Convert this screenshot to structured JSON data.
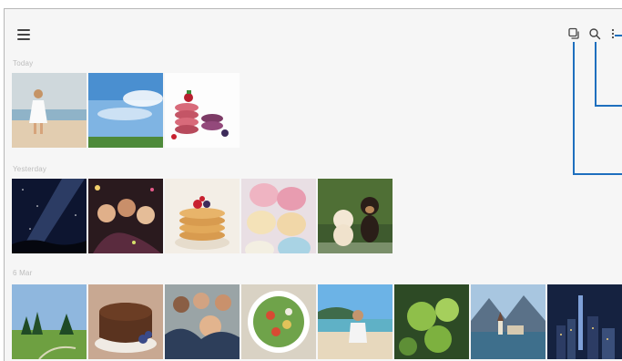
{
  "app_bar": {
    "menu_icon": "hamburger-menu-icon",
    "actions": [
      {
        "name": "select-mode-icon"
      },
      {
        "name": "search-icon"
      },
      {
        "name": "more-options-icon"
      }
    ]
  },
  "sections": {
    "today": {
      "label": "Today"
    },
    "yesterday": {
      "label": "Yesterday"
    },
    "older": {
      "label": "6 Mar"
    }
  },
  "photos": {
    "today": [
      "girl-on-beach",
      "blue-sky-field",
      "macarons-with-berries"
    ],
    "yesterday": [
      "milky-way-night-sky",
      "friends-party-selfie",
      "pancakes-with-berries",
      "pastel-macarons",
      "kitten-and-puppy"
    ],
    "older": [
      "forest-meadow",
      "chocolate-cake",
      "group-selfie",
      "salad-bowl",
      "girl-at-seaside",
      "green-hydrangeas",
      "lakeside-village",
      "city-skyline-night"
    ]
  },
  "colors": {
    "callout_line": "#1e6fbe",
    "background": "#f6f6f6"
  }
}
